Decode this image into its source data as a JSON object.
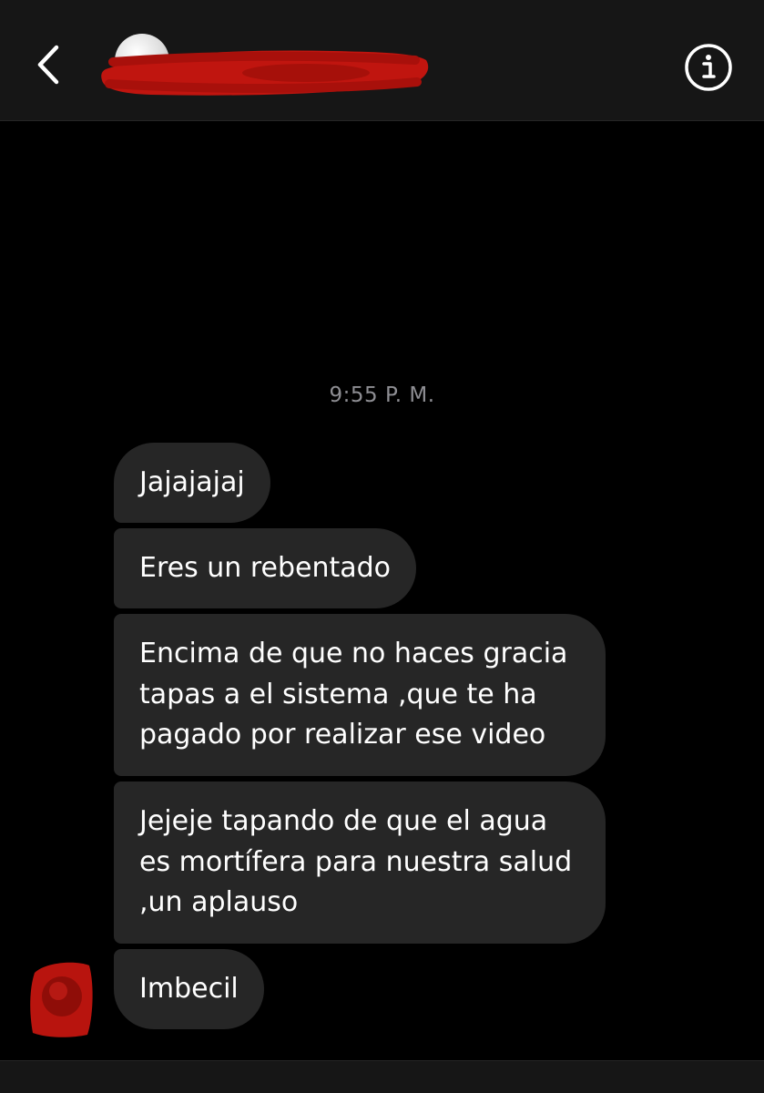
{
  "header": {
    "back_icon": "chevron-left-icon",
    "info_icon": "info-circle-icon",
    "contact_name_redacted": true,
    "redaction_color": "#c0150f"
  },
  "thread": {
    "timestamp": "9:55 P. M.",
    "messages": [
      {
        "text": "Jajajajaj"
      },
      {
        "text": "Eres un rebentado"
      },
      {
        "text": "Encima de que no haces gracia tapas a el sistema ,que te ha pagado por realizar ese video"
      },
      {
        "text": "Jejeje tapando de que el agua es mortífera para nuestra salud ,un aplauso"
      },
      {
        "text": "Imbecil"
      }
    ]
  },
  "colors": {
    "background": "#000000",
    "header_bg": "#161616",
    "bubble_bg": "#262626",
    "timestamp_color": "#8e8e93"
  }
}
